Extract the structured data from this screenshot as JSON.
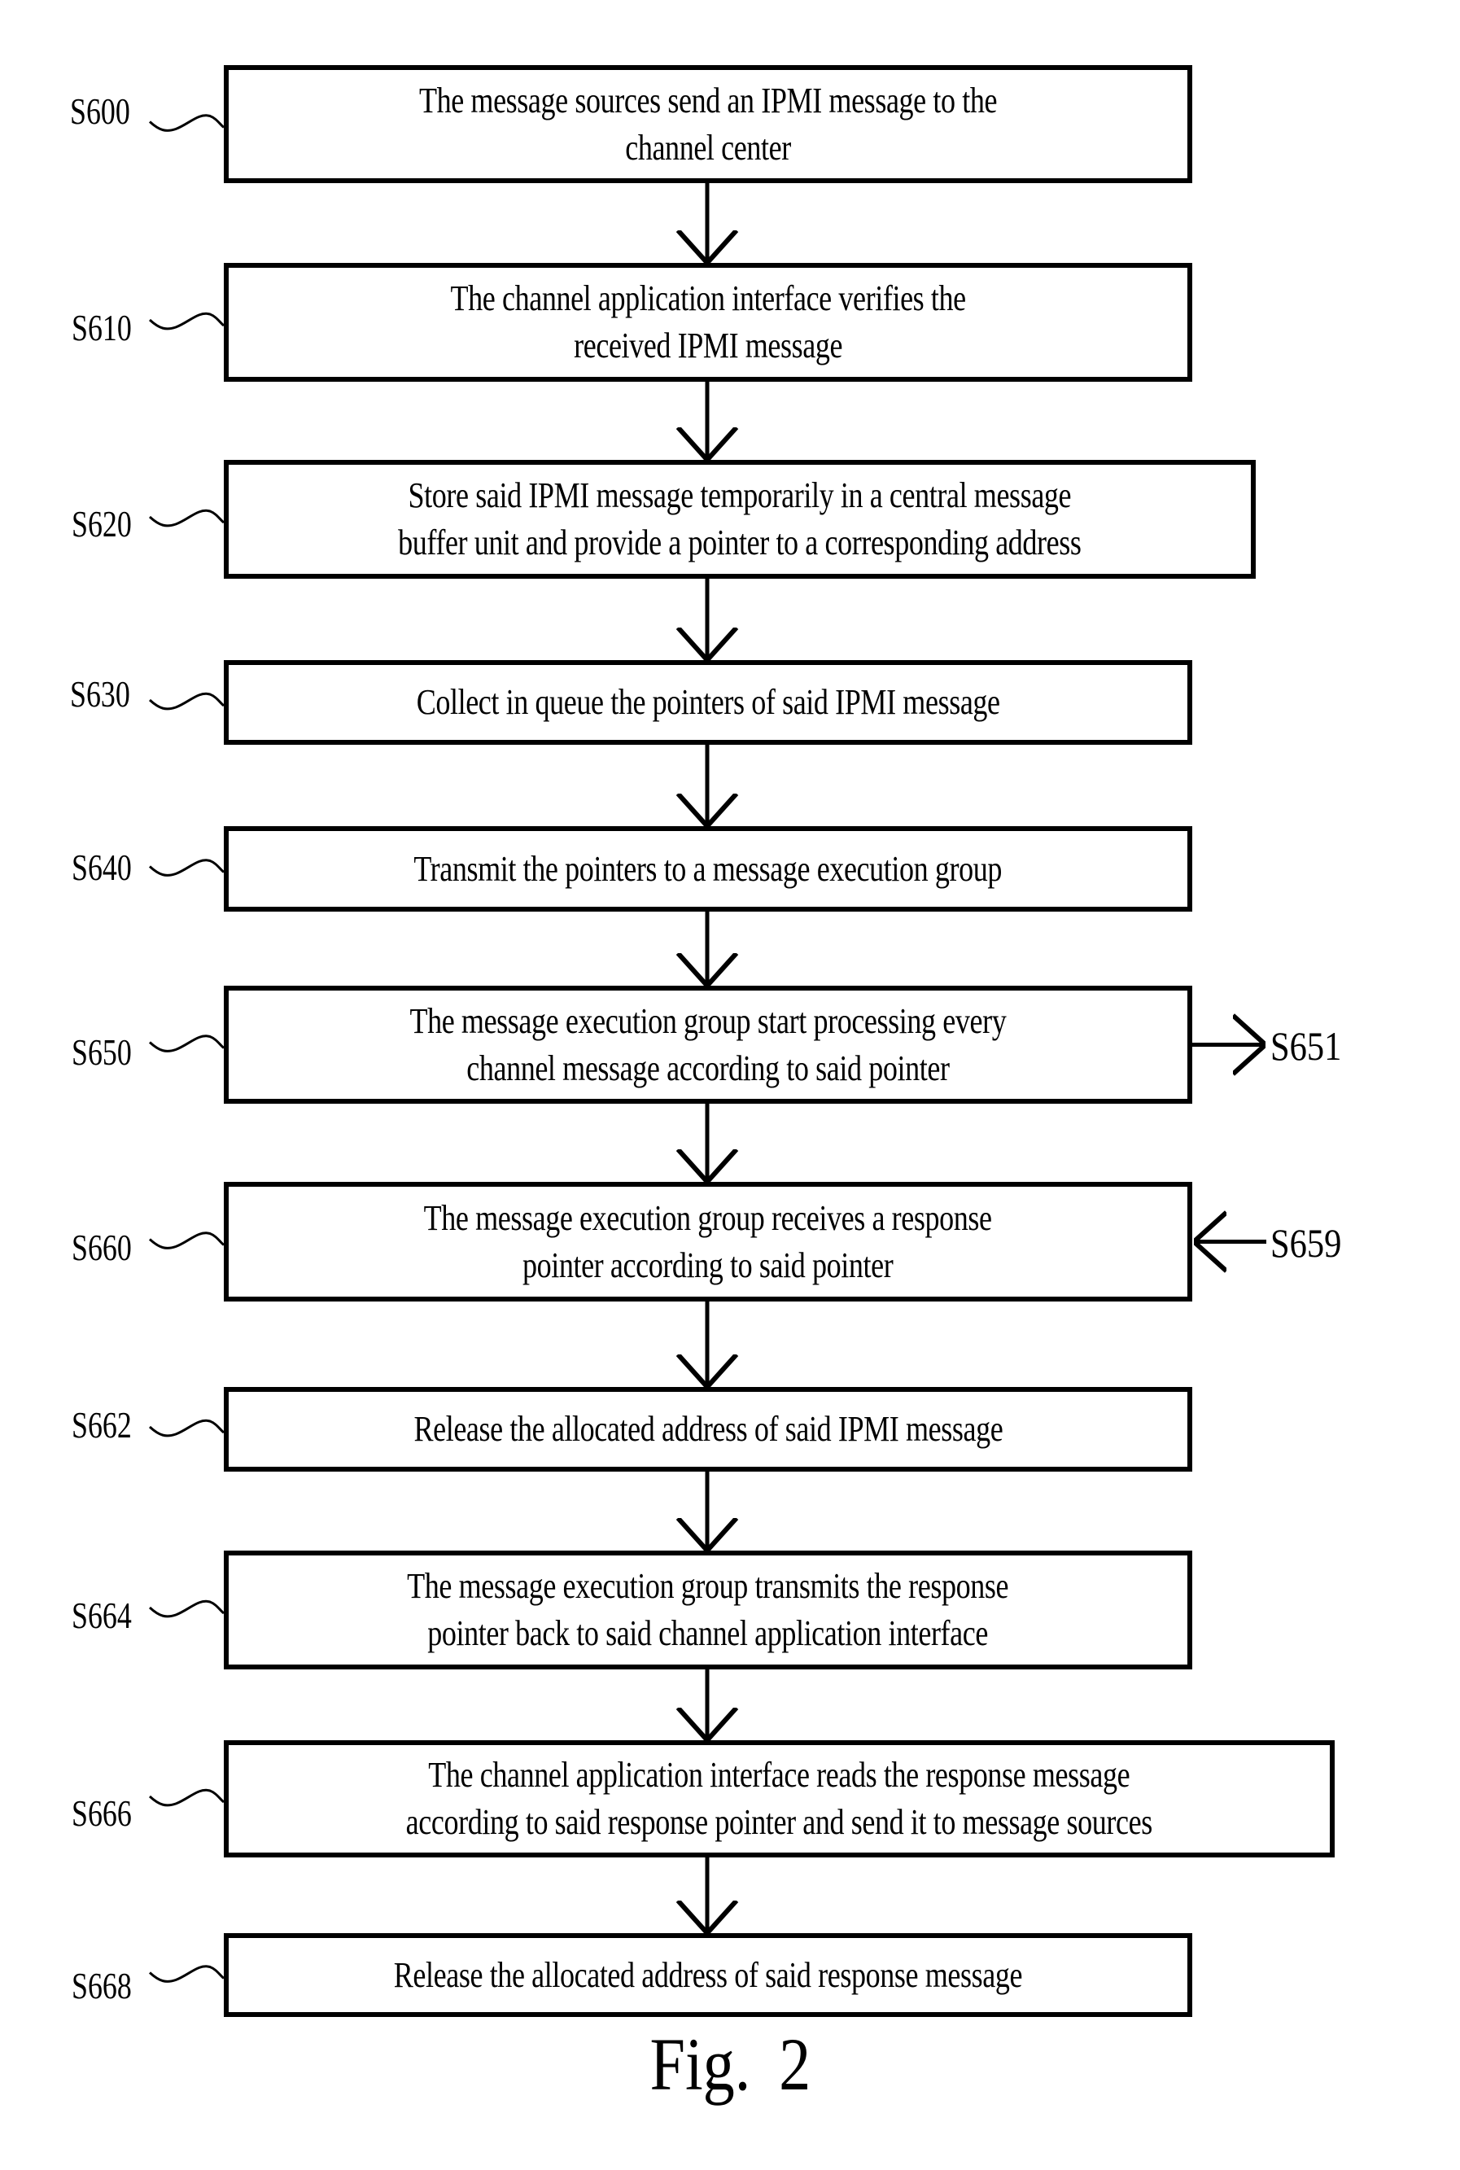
{
  "figure": {
    "title": "Fig.  2",
    "steps": [
      {
        "id": "S600",
        "text": "The message sources send an IPMI message to the\nchannel center"
      },
      {
        "id": "S610",
        "text": "The channel application interface verifies the\nreceived IPMI message"
      },
      {
        "id": "S620",
        "text": "Store said IPMI message temporarily in a central message\nbuffer unit and provide a pointer to a corresponding address"
      },
      {
        "id": "S630",
        "text": "Collect in queue the pointers of said IPMI message"
      },
      {
        "id": "S640",
        "text": "Transmit the pointers to a message execution group"
      },
      {
        "id": "S650",
        "text": "The message execution group start processing every\nchannel message according to said pointer"
      },
      {
        "id": "S660",
        "text": "The message execution group receives a response\npointer according to said pointer"
      },
      {
        "id": "S662",
        "text": "Release the allocated address of said IPMI message"
      },
      {
        "id": "S664",
        "text": "The message execution group transmits the response\npointer back to said channel application interface"
      },
      {
        "id": "S666",
        "text": "The channel application interface reads the response message\naccording to said response pointer and send it to message sources"
      },
      {
        "id": "S668",
        "text": "Release the allocated address of said response message"
      }
    ],
    "side_refs": {
      "outgoing": {
        "from": "S650",
        "label": "S651"
      },
      "incoming": {
        "to": "S660",
        "label": "S659"
      }
    }
  }
}
